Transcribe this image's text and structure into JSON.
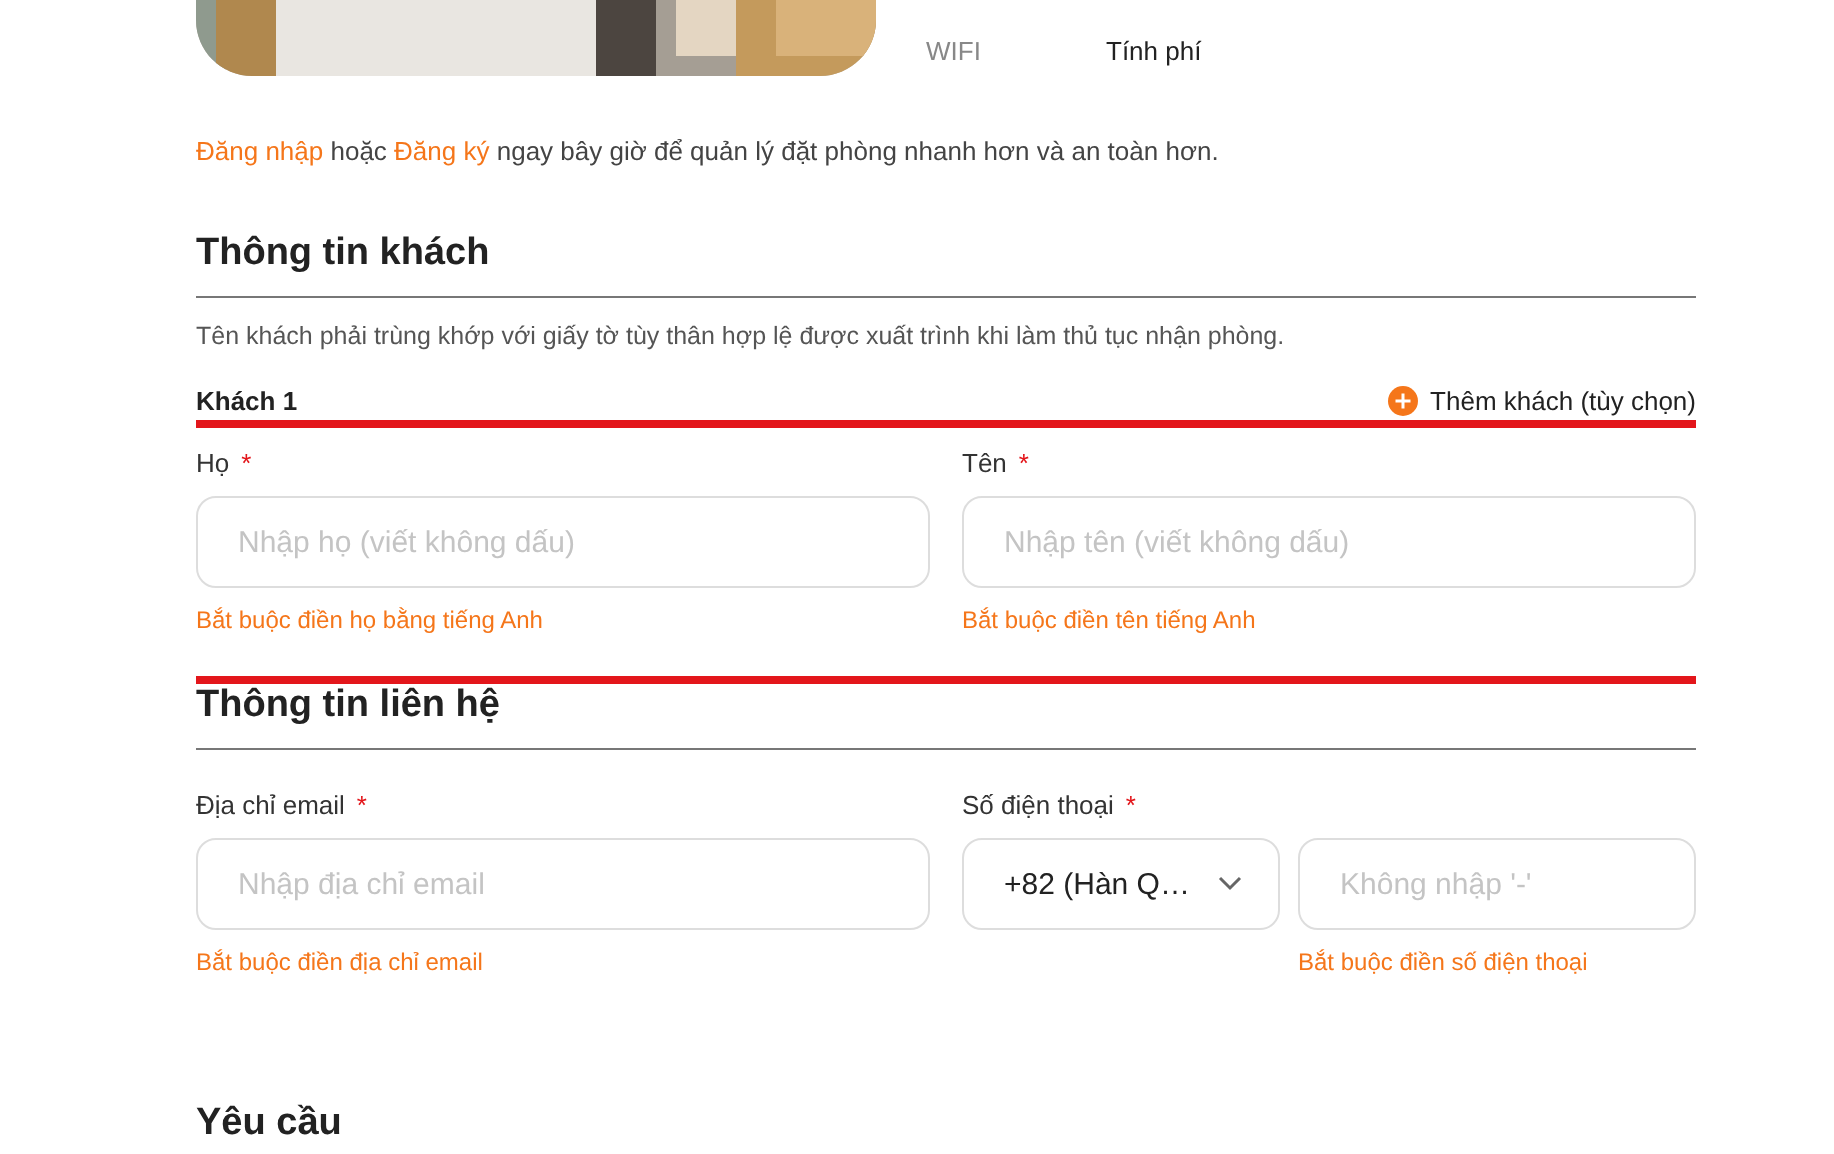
{
  "room_info": {
    "amenities": [
      {
        "label": "WIFI",
        "value": "Tính phí"
      }
    ]
  },
  "login_prompt": {
    "login_link": "Đăng nhập",
    "or": "hoặc",
    "register_link": "Đăng ký",
    "rest": "ngay bây giờ để quản lý đặt phòng nhanh hơn và an toàn hơn."
  },
  "guest_info": {
    "title": "Thông tin khách",
    "note": "Tên khách phải trùng khớp với giấy tờ tùy thân hợp lệ được xuất trình khi làm thủ tục nhận phòng.",
    "guest_label": "Khách 1",
    "add_guest": "Thêm khách (tùy chọn)",
    "fields": [
      {
        "label": "Họ",
        "required_mark": "*",
        "placeholder": "Nhập họ (viết không dấu)",
        "error": "Bắt buộc điền họ bằng tiếng Anh"
      },
      {
        "label": "Tên",
        "required_mark": "*",
        "placeholder": "Nhập tên (viết không dấu)",
        "error": "Bắt buộc điền tên tiếng Anh"
      }
    ]
  },
  "contact_info": {
    "title": "Thông tin liên hệ",
    "email": {
      "label": "Địa chỉ email",
      "required_mark": "*",
      "placeholder": "Nhập địa chỉ email",
      "error": "Bắt buộc điền địa chỉ email"
    },
    "phone": {
      "label": "Số điện thoại",
      "required_mark": "*",
      "country_code": "+82 (Hàn Q…",
      "placeholder": "Không nhập '-'",
      "error": "Bắt buộc điền số điện thoại"
    }
  },
  "requests": {
    "title": "Yêu cầu"
  }
}
